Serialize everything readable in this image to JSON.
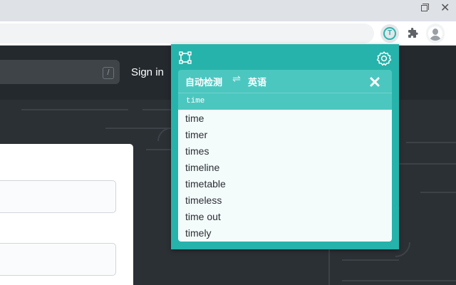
{
  "colors": {
    "accent": "#26b3ab",
    "accent_light": "#4cc7c0",
    "page_header": "#24292e",
    "chrome": "#dee1e6"
  },
  "browser": {
    "window_buttons": [
      "restore-icon",
      "close-icon"
    ],
    "close_glyph": "✕",
    "extensions": [
      "translator-extension-icon",
      "puzzle-icon",
      "avatar-icon"
    ],
    "active_extension_glyph": "T"
  },
  "page": {
    "search_shortcut": "/",
    "signin_label": "Sign in"
  },
  "popup": {
    "tools": [
      "screen-select-icon",
      "gear-icon"
    ],
    "source_language": "自动检测",
    "swap_glyph": "⇌",
    "target_language": "英语",
    "input_text": "time",
    "suggestions": [
      "time",
      "timer",
      "times",
      "timeline",
      "timetable",
      "timeless",
      "time out",
      "timely"
    ]
  }
}
